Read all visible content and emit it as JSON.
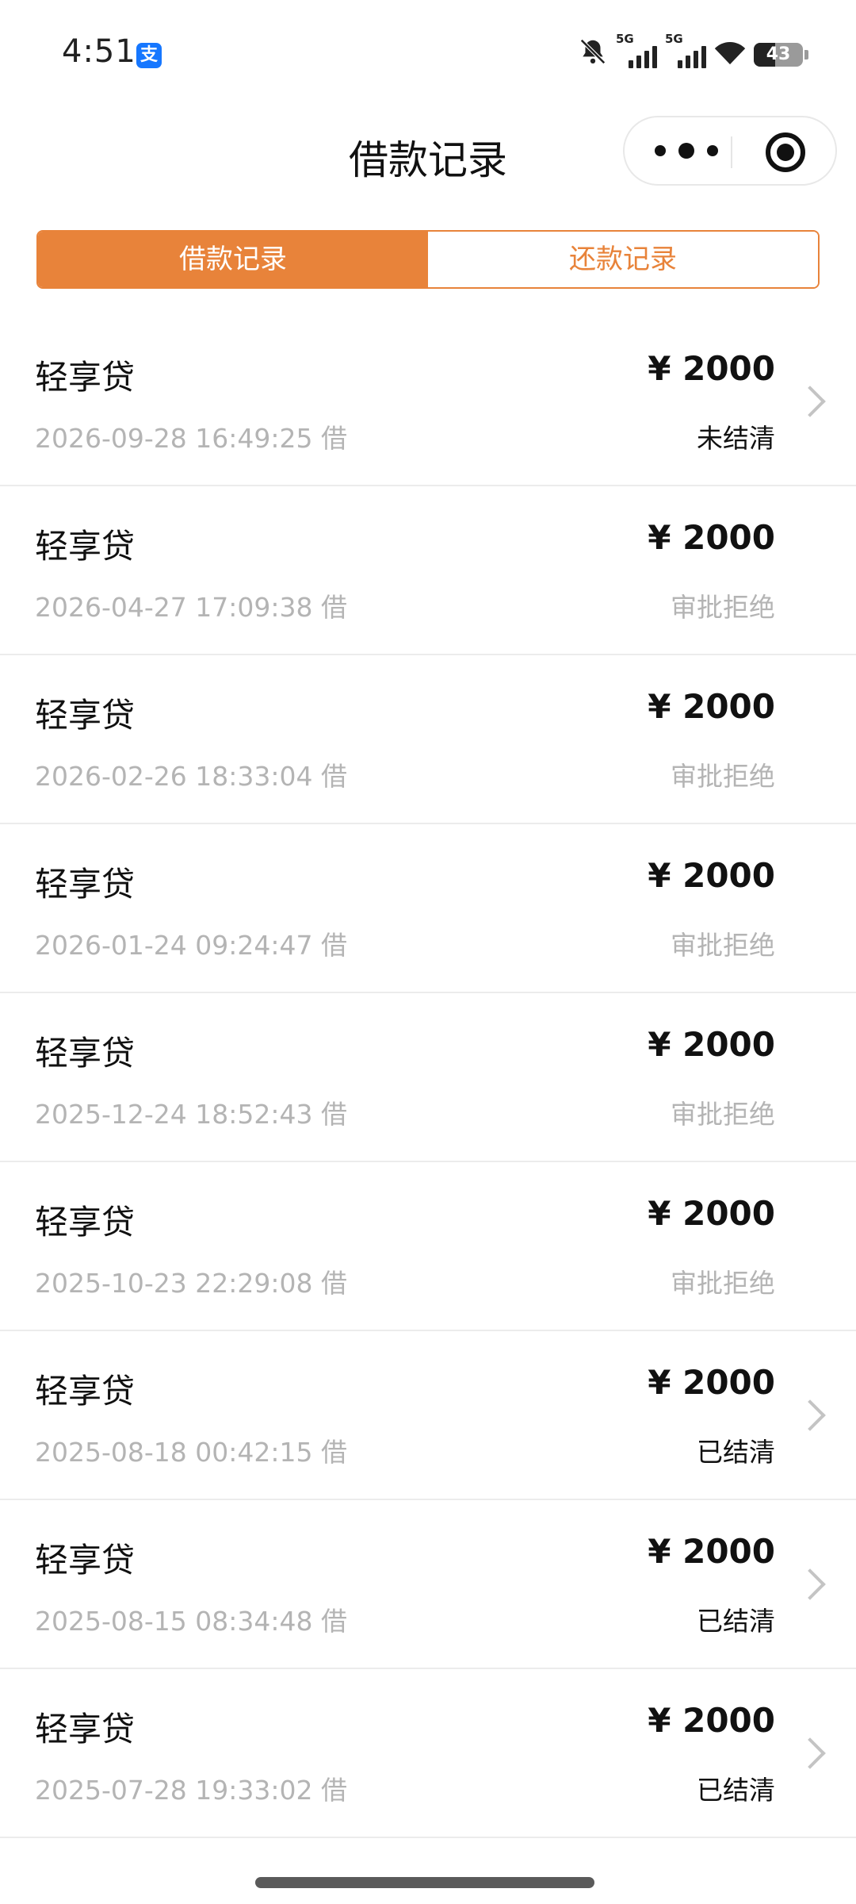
{
  "status_bar": {
    "time": "4:51",
    "app_icon": "支",
    "network_1": "5G",
    "network_2": "5G",
    "battery": "43",
    "battery_level": 0.43
  },
  "header": {
    "title": "借款记录",
    "more_icon": "more-dots-icon",
    "close_icon": "target-circle-icon"
  },
  "tabs": [
    {
      "label": "借款记录",
      "active": true
    },
    {
      "label": "还款记录",
      "active": false
    }
  ],
  "records": [
    {
      "name": "轻享贷",
      "date": "2026-09-28 16:49:25 借",
      "amount": "¥ 2000",
      "status": "未结清",
      "status_type": "pending",
      "has_arrow": true
    },
    {
      "name": "轻享贷",
      "date": "2026-04-27 17:09:38 借",
      "amount": "¥ 2000",
      "status": "审批拒绝",
      "status_type": "rejected",
      "has_arrow": false
    },
    {
      "name": "轻享贷",
      "date": "2026-02-26 18:33:04 借",
      "amount": "¥ 2000",
      "status": "审批拒绝",
      "status_type": "rejected",
      "has_arrow": false
    },
    {
      "name": "轻享贷",
      "date": "2026-01-24 09:24:47 借",
      "amount": "¥ 2000",
      "status": "审批拒绝",
      "status_type": "rejected",
      "has_arrow": false
    },
    {
      "name": "轻享贷",
      "date": "2025-12-24 18:52:43 借",
      "amount": "¥ 2000",
      "status": "审批拒绝",
      "status_type": "rejected",
      "has_arrow": false
    },
    {
      "name": "轻享贷",
      "date": "2025-10-23 22:29:08 借",
      "amount": "¥ 2000",
      "status": "审批拒绝",
      "status_type": "rejected",
      "has_arrow": false
    },
    {
      "name": "轻享贷",
      "date": "2025-08-18 00:42:15 借",
      "amount": "¥ 2000",
      "status": "已结清",
      "status_type": "settled",
      "has_arrow": true
    },
    {
      "name": "轻享贷",
      "date": "2025-08-15 08:34:48 借",
      "amount": "¥ 2000",
      "status": "已结清",
      "status_type": "settled",
      "has_arrow": true
    },
    {
      "name": "轻享贷",
      "date": "2025-07-28 19:33:02 借",
      "amount": "¥ 2000",
      "status": "已结清",
      "status_type": "settled",
      "has_arrow": true
    }
  ]
}
